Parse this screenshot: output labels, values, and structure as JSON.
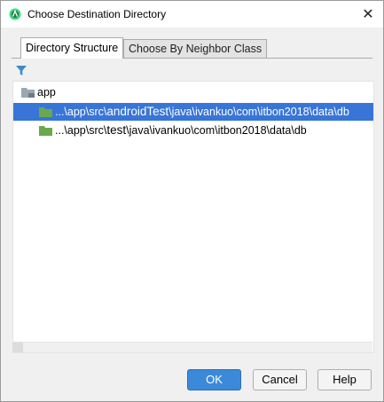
{
  "window": {
    "title": "Choose Destination Directory",
    "app_icon": "android-studio-icon",
    "close_glyph": "✕"
  },
  "tabs": [
    {
      "label": "Directory Structure",
      "active": true
    },
    {
      "label": "Choose By Neighbor Class",
      "active": false
    }
  ],
  "toolbar": {
    "filter_icon": "filter-icon"
  },
  "tree": {
    "root": {
      "label": "app",
      "icon": "module-folder-icon"
    },
    "items": [
      {
        "prefix": "...\\app\\src\\",
        "highlight": "androidTest",
        "suffix": "\\java\\ivankuo\\com\\itbon2018\\data\\db",
        "selected": true,
        "icon": "test-source-folder-icon"
      },
      {
        "prefix": "...\\app\\src\\",
        "highlight": "test",
        "suffix": "\\java\\ivankuo\\com\\itbon2018\\data\\db",
        "selected": false,
        "icon": "test-source-folder-icon"
      }
    ]
  },
  "buttons": {
    "ok": "OK",
    "cancel": "Cancel",
    "help": "Help"
  },
  "colors": {
    "selection": "#3875d7",
    "ok_button": "#3b8ad9",
    "test_folder": "#6aa84f"
  }
}
